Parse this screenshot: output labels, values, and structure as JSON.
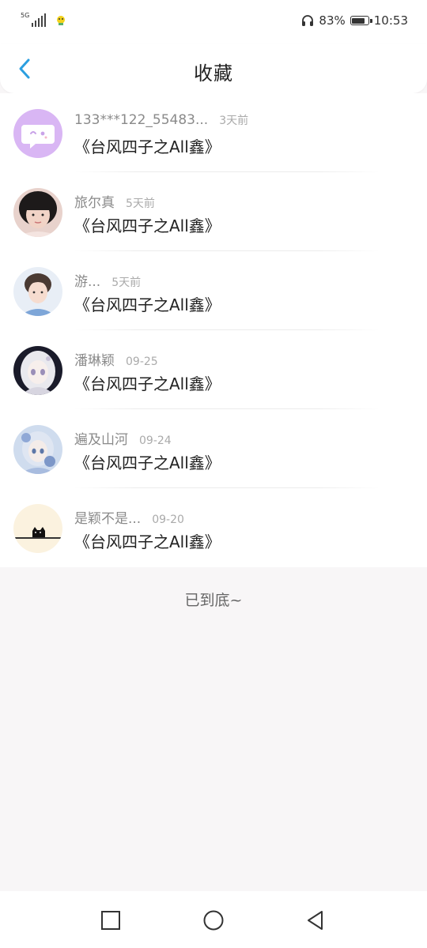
{
  "status_bar": {
    "network": "5G",
    "battery_percent": "83%",
    "battery_level": 0.83,
    "time": "10:53"
  },
  "header": {
    "title": "收藏"
  },
  "items": [
    {
      "username": "133***122_55483...",
      "time": "3天前",
      "title": "《台风四子之All鑫》",
      "avatar": "chat-bubble-avatar"
    },
    {
      "username": "旅尔真",
      "time": "5天前",
      "title": "《台风四子之All鑫》",
      "avatar": "user-photo-avatar"
    },
    {
      "username": "游...",
      "time": "5天前",
      "title": "《台风四子之All鑫》",
      "avatar": "user-photo-avatar"
    },
    {
      "username": "潘琳颖",
      "time": "09-25",
      "title": "《台风四子之All鑫》",
      "avatar": "anime-avatar"
    },
    {
      "username": "遍及山河",
      "time": "09-24",
      "title": "《台风四子之All鑫》",
      "avatar": "anime-avatar"
    },
    {
      "username": "是颖不是...",
      "time": "09-20",
      "title": "《台风四子之All鑫》",
      "avatar": "black-cat-avatar"
    }
  ],
  "footer": {
    "end_text": "已到底~"
  },
  "nav": {
    "recent": "square-icon",
    "home": "circle-icon",
    "back": "triangle-back-icon"
  },
  "colors": {
    "accent": "#2c9fe0",
    "background": "#f8f6f7"
  }
}
